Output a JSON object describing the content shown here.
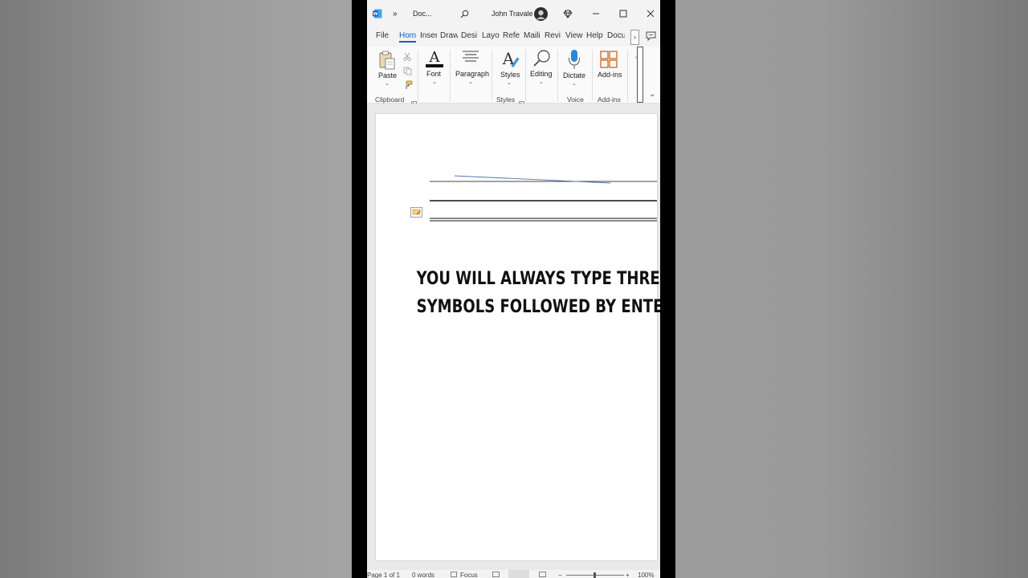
{
  "titlebar": {
    "doc_name": "Doc...",
    "more": "»",
    "user_name": "John Travale"
  },
  "menu": {
    "tabs": [
      {
        "label": "File"
      },
      {
        "label": "Hom"
      },
      {
        "label": "Inser"
      },
      {
        "label": "Draw"
      },
      {
        "label": "Desi"
      },
      {
        "label": "Layo"
      },
      {
        "label": "Refe"
      },
      {
        "label": "Maili"
      },
      {
        "label": "Revi"
      },
      {
        "label": "View"
      },
      {
        "label": "Help"
      },
      {
        "label": "Docu"
      }
    ],
    "overflow": "›"
  },
  "ribbon": {
    "paste": "Paste",
    "font": "Font",
    "paragraph": "Paragraph",
    "styles": "Styles",
    "editing": "Editing",
    "dictate": "Dictate",
    "addins": "Add-ins",
    "groups": {
      "clipboard": "Clipboard",
      "styles": "Styles",
      "voice": "Voice",
      "addins": "Add-ins"
    },
    "scroll_right": "›",
    "expand": "⌄"
  },
  "document": {
    "line1": "YOU WILL ALWAYS TYPE THREE",
    "line2": "SYMBOLS FOLLOWED BY ENTER"
  },
  "status": {
    "page": "Page 1 of 1",
    "words": "0 words",
    "focus": "Focus",
    "zoom": "100%"
  },
  "colors": {
    "accent": "#1a5fb4",
    "word_blue": "#185abd",
    "page_bg": "#ffffff",
    "chrome_bg": "#f3f3f3"
  }
}
